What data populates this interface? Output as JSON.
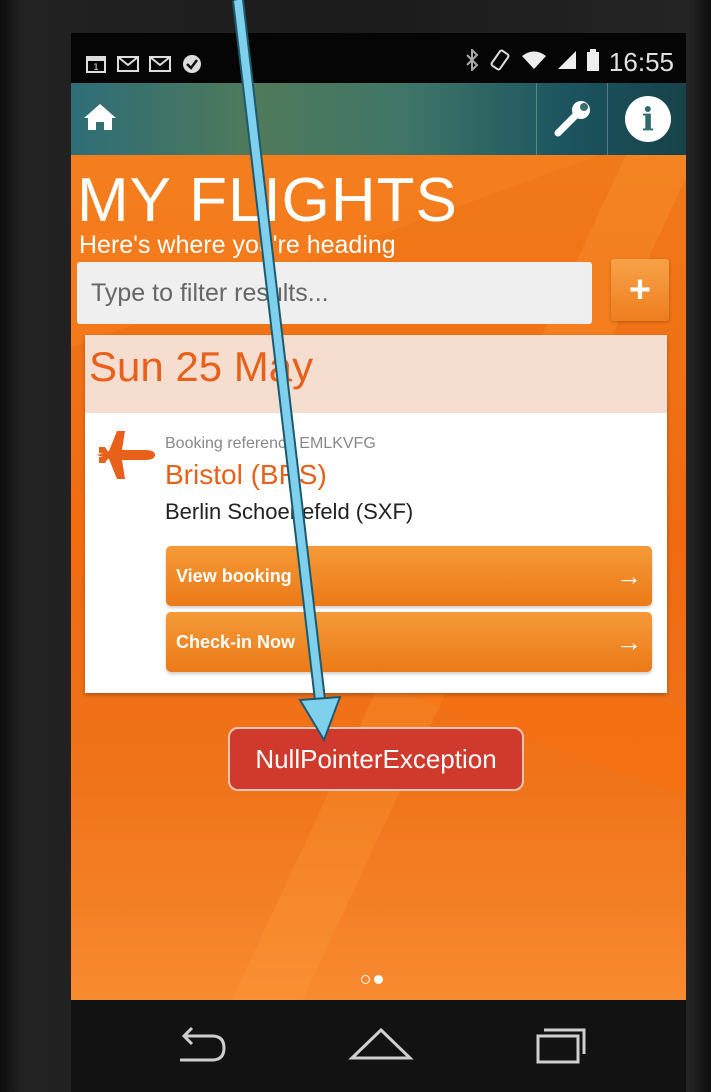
{
  "status_bar": {
    "time": "16:55",
    "notification_icons": [
      "calendar-icon",
      "gmail-icon",
      "gmail-icon",
      "check-badge-icon"
    ],
    "system_icons": [
      "bluetooth-icon",
      "rotation-icon",
      "wifi-icon",
      "signal-icon",
      "battery-icon"
    ]
  },
  "action_bar": {
    "home_icon": "home-icon",
    "settings_icon": "wrench-icon",
    "info_icon": "info-icon",
    "info_glyph": "i"
  },
  "main": {
    "title": "MY FLIGHTS",
    "subtitle": "Here's where you're heading",
    "filter_placeholder": "Type to filter results...",
    "add_label": "+",
    "booking": {
      "date": "Sun 25 May",
      "reference": "Booking reference EMLKVFG",
      "from": "Bristol (BRS)",
      "to": "Berlin Schoenefeld (SXF)",
      "view_booking_label": "View booking",
      "check_in_label": "Check-in Now",
      "arrow_glyph": "→"
    },
    "error_toast": "NullPointerException",
    "page_indicator": {
      "count": 2,
      "active_index": 1
    }
  },
  "nav_bar": {
    "back_icon": "back-icon",
    "home_icon": "home-outline-icon",
    "recents_icon": "recents-icon"
  },
  "colors": {
    "accent_orange": "#f07a1a",
    "date_orange": "#e8611a",
    "toast_red": "#cf3a2c",
    "annotation_blue": "#7ed0ec"
  }
}
